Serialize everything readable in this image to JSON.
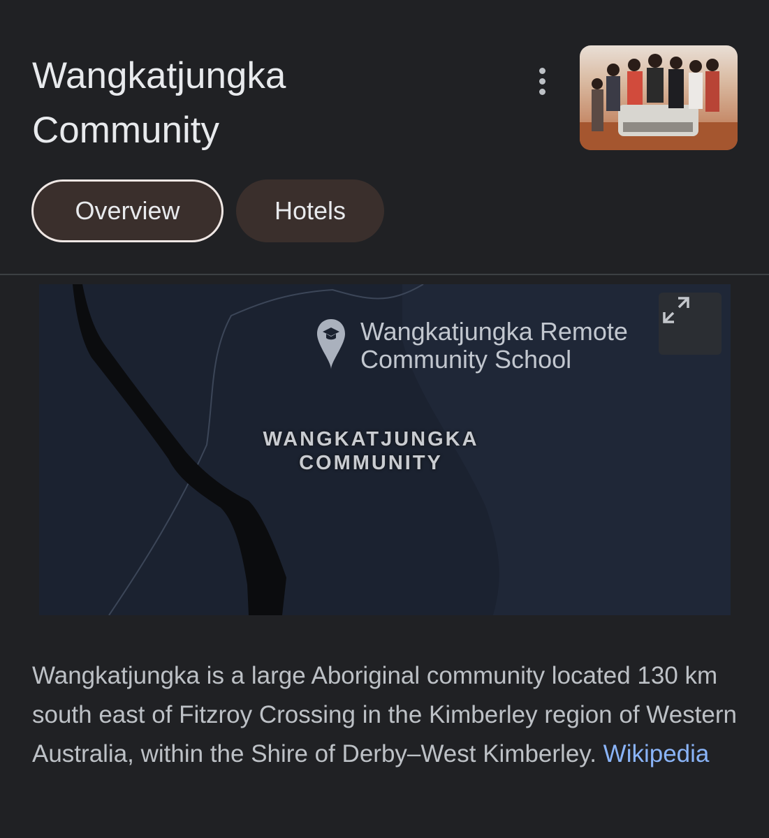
{
  "header": {
    "title": "Wangkatjungka Community",
    "more_icon": "more-vert-icon"
  },
  "tabs": [
    {
      "label": "Overview",
      "active": true
    },
    {
      "label": "Hotels",
      "active": false
    }
  ],
  "map": {
    "poi_label_line1": "Wangkatjungka Remote",
    "poi_label_line2": "Community School",
    "poi_icon": "school-pin-icon",
    "area_label_line1": "WANGKATJUNGKA",
    "area_label_line2": "COMMUNITY",
    "expand_icon": "fullscreen-icon"
  },
  "description": {
    "text": "Wangkatjungka is a large Aboriginal community located 130 km south east of Fitzroy Crossing in the Kimberley region of Western Australia, within the Shire of Derby–West Kimberley. ",
    "source_link": "Wikipedia"
  },
  "colors": {
    "background": "#202124",
    "tab_fill": "#3a2f2c",
    "link": "#8ab4f8"
  }
}
